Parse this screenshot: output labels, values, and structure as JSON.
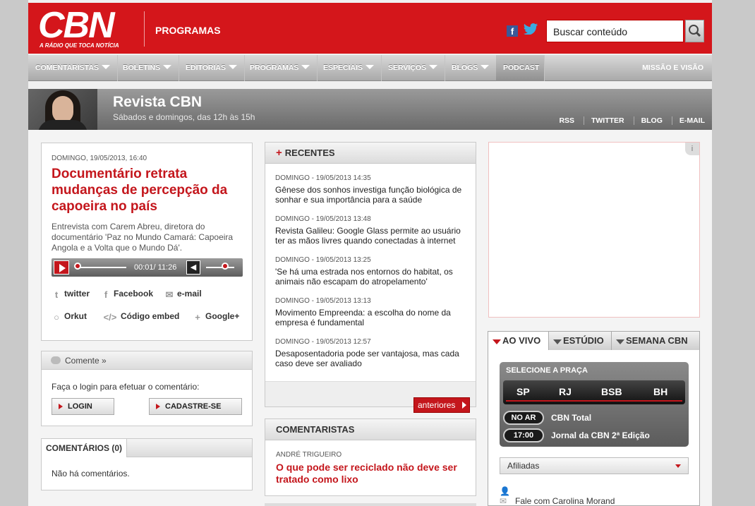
{
  "header": {
    "logo": "CBN",
    "tagline": "A RÁDIO QUE TOCA NOTÍCIA",
    "section": "PROGRAMAS",
    "facebook_icon_label": "f",
    "search_placeholder": "Buscar conteúdo"
  },
  "nav": {
    "items": [
      {
        "label": "COMENTARISTAS",
        "dropdown": true
      },
      {
        "label": "BOLETINS",
        "dropdown": true
      },
      {
        "label": "EDITORIAS",
        "dropdown": true
      },
      {
        "label": "PROGRAMAS",
        "dropdown": true
      },
      {
        "label": "ESPECIAIS",
        "dropdown": true
      },
      {
        "label": "SERVIÇOS",
        "dropdown": true
      },
      {
        "label": "BLOGS",
        "dropdown": true
      },
      {
        "label": "PODCAST",
        "dropdown": false
      }
    ],
    "right": "MISSÃO E VISÃO"
  },
  "program": {
    "title": "Revista CBN",
    "schedule": "Sábados e domingos, das 12h às 15h",
    "links": [
      "RSS",
      "TWITTER",
      "BLOG",
      "E-MAIL"
    ]
  },
  "article": {
    "date": "DOMINGO, 19/05/2013, 16:40",
    "title": "Documentário retrata mudanças de percepção da capoeira no país",
    "description": "Entrevista com Carem Abreu, diretora do documentário 'Paz no Mundo Camará: Capoeira Angola e a Volta que o Mundo Dá'.",
    "player": {
      "time": "00:01/ 11:26",
      "progress": 0.0015,
      "volume": 0.7
    },
    "share": {
      "twitter": "twitter",
      "facebook": "Facebook",
      "email": "e-mail",
      "orkut": "Orkut",
      "embed": "Código embed",
      "google": "Google+"
    }
  },
  "comment_box": {
    "header": "Comente »",
    "prompt": "Faça o login para efetuar o comentário:",
    "login": "LOGIN",
    "signup": "CADASTRE-SE"
  },
  "comments": {
    "header": "COMENTÁRIOS (0)",
    "empty": "Não há comentários."
  },
  "recentes": {
    "header": "RECENTES",
    "items": [
      {
        "date": "DOMINGO - 19/05/2013 14:35",
        "text": "Gênese dos sonhos investiga função biológica de sonhar e sua importância para a saúde"
      },
      {
        "date": "DOMINGO - 19/05/2013 13:48",
        "text": "Revista Galileu: Google Glass permite ao usuário ter as mãos livres quando conectadas à internet"
      },
      {
        "date": "DOMINGO - 19/05/2013 13:25",
        "text": "'Se há uma estrada nos entornos do habitat, os animais não escapam do atropelamento'"
      },
      {
        "date": "DOMINGO - 19/05/2013 13:13",
        "text": "Movimento Empreenda: a escolha do nome da empresa é fundamental"
      },
      {
        "date": "DOMINGO - 19/05/2013 12:57",
        "text": "Desaposentadoria pode ser vantajosa, mas cada caso deve ser avaliado"
      }
    ],
    "more": "anteriores"
  },
  "comentaristas": {
    "header": "COMENTARISTAS",
    "author": "ANDRÉ TRIGUEIRO",
    "title": "O que pode ser reciclado não deve ser tratado como lixo"
  },
  "ad": {
    "info": "i"
  },
  "live": {
    "tabs": [
      "AO VIVO",
      "ESTÚDIO",
      "SEMANA CBN"
    ],
    "select_label": "SELECIONE A PRAÇA",
    "cities": [
      "SP",
      "RJ",
      "BSB",
      "BH"
    ],
    "now": {
      "badge": "NO AR",
      "text": "CBN Total"
    },
    "next": {
      "badge": "17:00",
      "text": "Jornal da CBN 2ª Edição"
    },
    "afiliadas": "Afiliadas",
    "fale": "Fale com Carolina Morand"
  },
  "colors": {
    "brand_red": "#d4161b",
    "link_red": "#c4161c"
  }
}
